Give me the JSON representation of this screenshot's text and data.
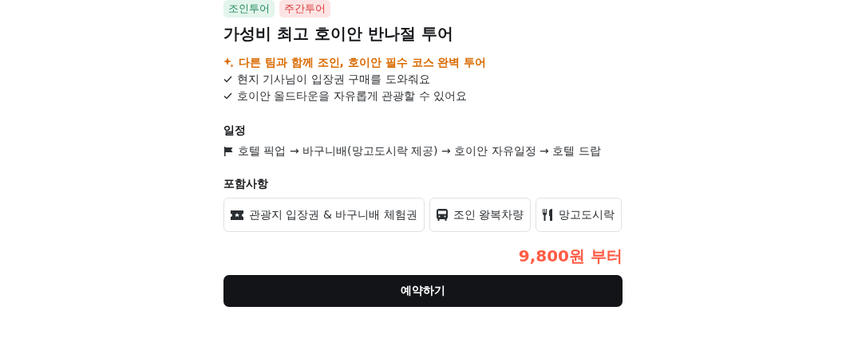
{
  "tags": [
    {
      "label": "조인투어",
      "color": "#e3f5ec"
    },
    {
      "label": "주간투어",
      "color": "#fde4e4"
    }
  ],
  "title": "가성비 최고 호이안 반나절 투어",
  "highlight": "다른 팀과 함께 조인, 호이안 필수 코스 완벽 투어",
  "checks": [
    "현지 기사님이 입장권 구매를 도와줘요",
    "호이안 올드타운을 자유롭게 관광할 수 있어요"
  ],
  "schedule": {
    "heading": "일정",
    "route": "호텔 픽업 → 바구니배(망고도시락 제공) → 호이안 자유일정 → 호텔 드랍"
  },
  "includes": {
    "heading": "포함사항",
    "items": [
      {
        "kind": "ticket",
        "label": "관광지 입장권 & 바구니배 체험권"
      },
      {
        "kind": "bus",
        "label": "조인 왕복차량"
      },
      {
        "kind": "meal",
        "label": "망고도시락"
      }
    ]
  },
  "price": "9,800원 부터",
  "book_button": "예약하기"
}
